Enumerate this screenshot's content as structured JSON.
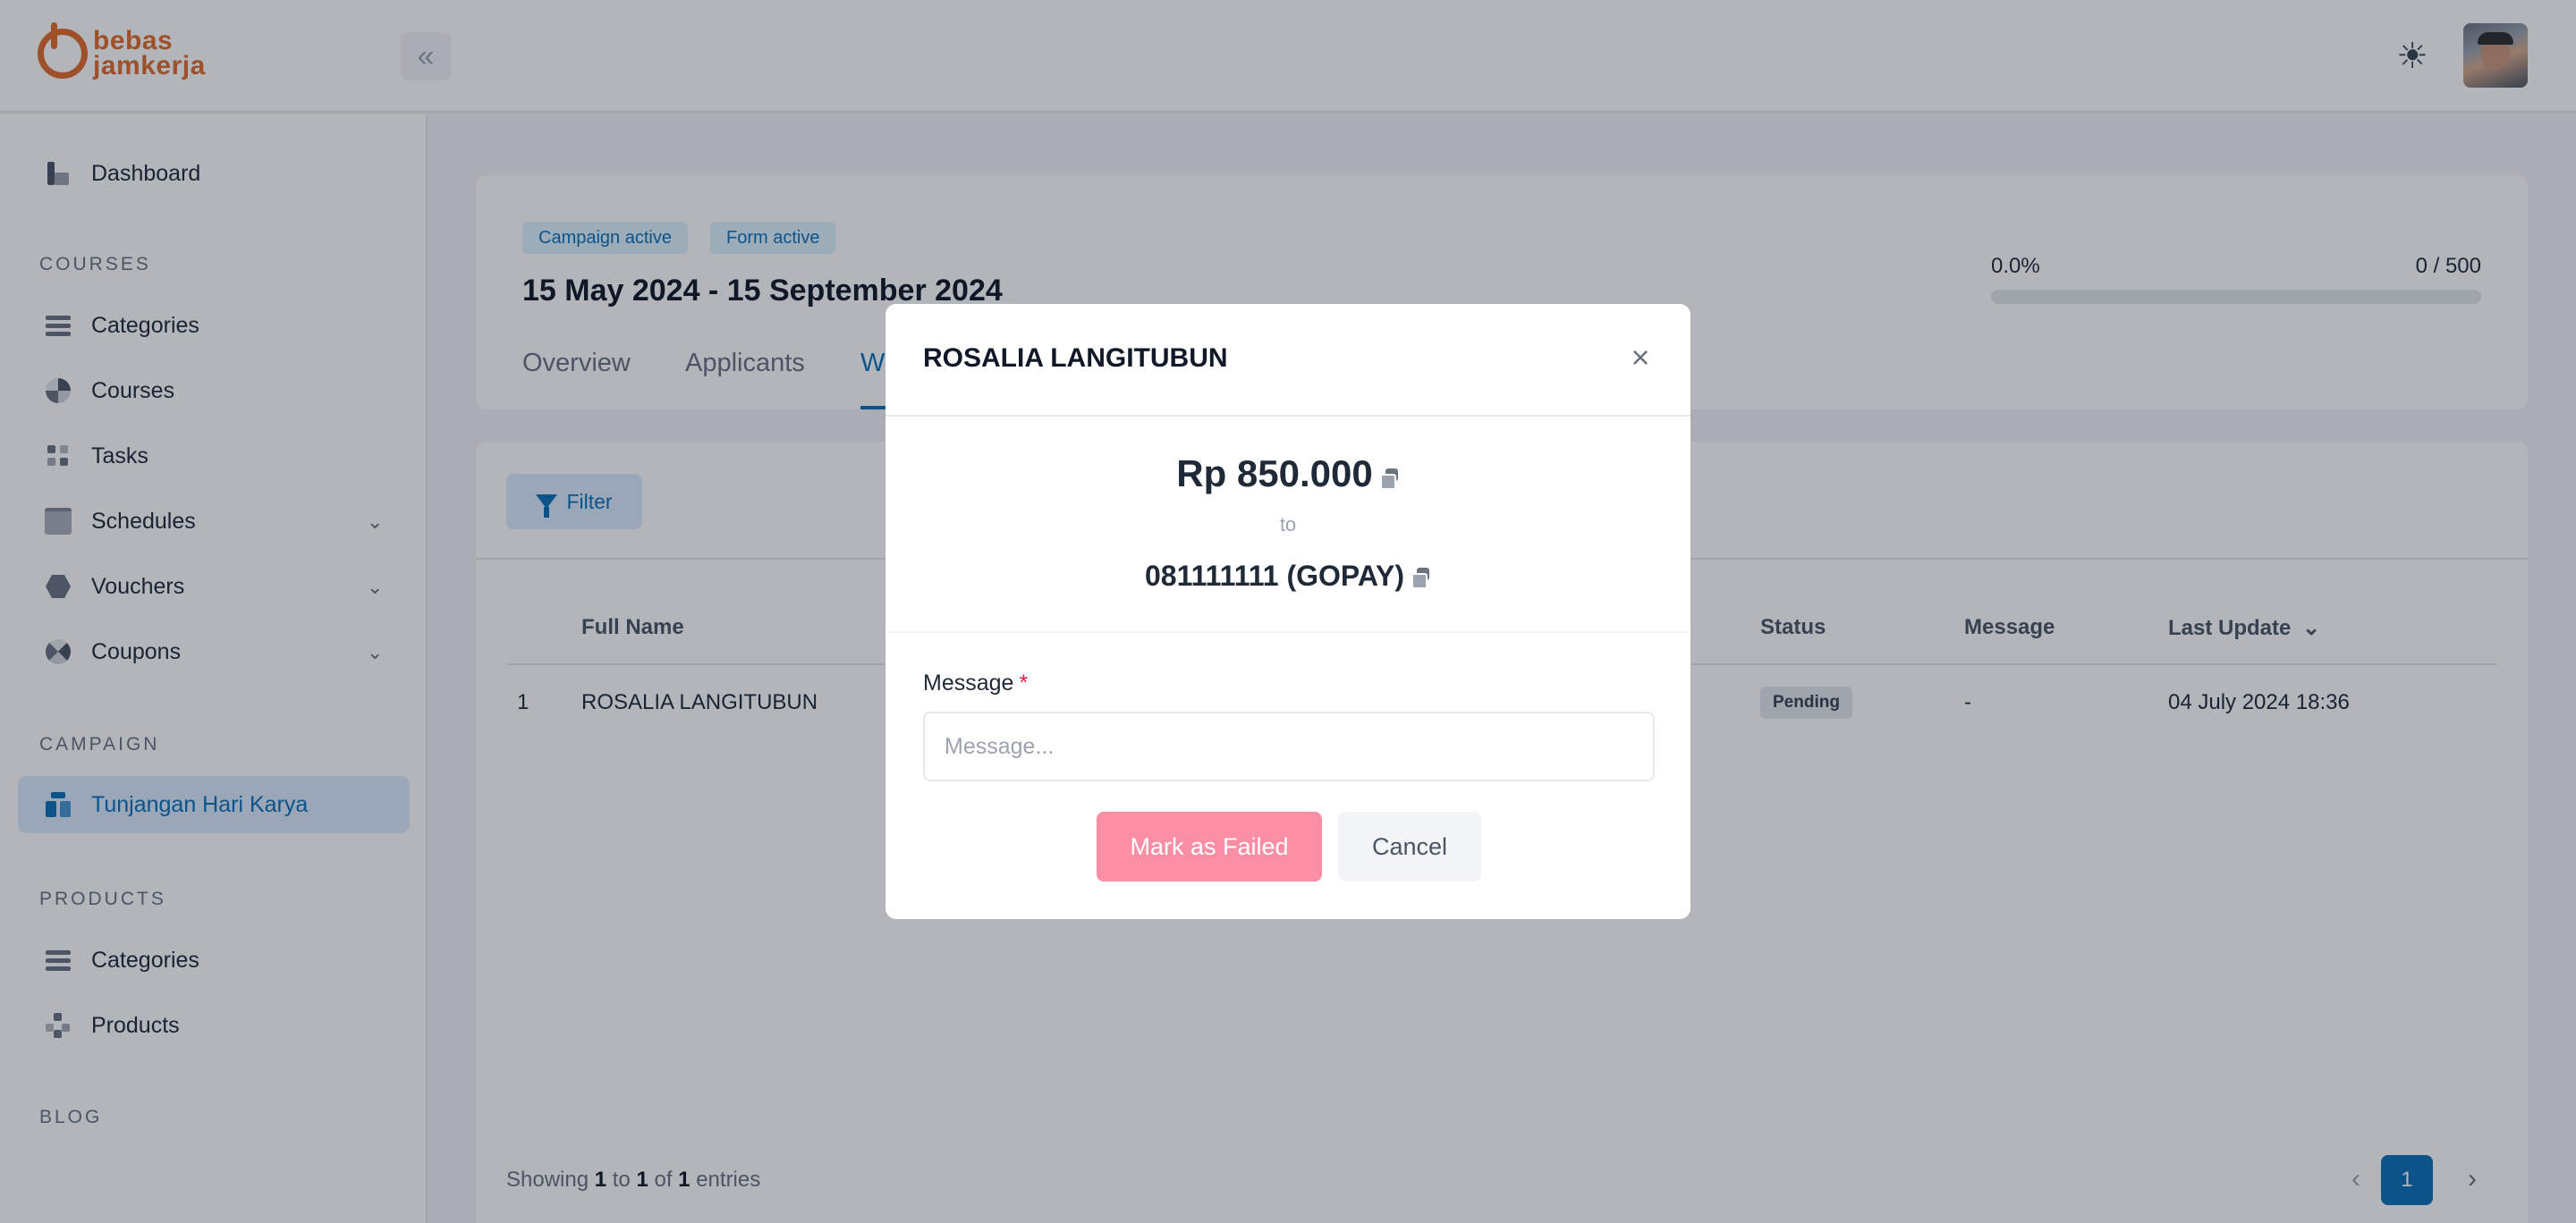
{
  "brand": {
    "line1": "bebas",
    "line2": "jamkerja",
    "color": "#e06a2c"
  },
  "topbar": {
    "collapse_icon": "chevrons-left-icon",
    "theme_icon": "sun-icon"
  },
  "sidebar": {
    "dashboard": "Dashboard",
    "sections": {
      "courses": "COURSES",
      "campaign": "CAMPAIGN",
      "products": "PRODUCTS",
      "blog": "BLOG"
    },
    "courses_items": [
      "Categories",
      "Courses",
      "Tasks",
      "Schedules",
      "Vouchers",
      "Coupons"
    ],
    "campaign_items": [
      "Tunjangan Hari Karya"
    ],
    "products_items": [
      "Categories",
      "Products"
    ]
  },
  "campaign": {
    "badges": [
      "Campaign active",
      "Form active"
    ],
    "date_range": "15 May 2024 - 15 September 2024",
    "tabs": [
      "Overview",
      "Applicants",
      "W"
    ],
    "active_tab": "W",
    "progress": {
      "percent_label": "0.0%",
      "count_label": "0 / 500",
      "fraction": 0.0
    }
  },
  "table": {
    "filter_label": "Filter",
    "headers": {
      "full_name": "Full Name",
      "status": "Status",
      "message": "Message",
      "last_update": "Last Update"
    },
    "rows": [
      {
        "no": "1",
        "full_name": "ROSALIA LANGITUBUN",
        "status": "Pending",
        "message": "-",
        "last_update": "04 July 2024 18:36"
      }
    ],
    "footer": {
      "showing": "Showing",
      "from": "1",
      "to_word": "to",
      "to": "1",
      "of_word": "of",
      "total": "1",
      "entries": "entries"
    },
    "pagination": {
      "current": "1"
    }
  },
  "modal": {
    "title": "ROSALIA LANGITUBUN",
    "amount": "Rp 850.000",
    "to_label": "to",
    "account": "081111111 (GOPAY)",
    "message_label": "Message",
    "required_mark": "*",
    "message_placeholder": "Message...",
    "message_value": "",
    "failed_button": "Mark as Failed",
    "cancel_button": "Cancel"
  },
  "colors": {
    "accent": "#0b6fb8",
    "danger_soft": "#f98ea5",
    "required": "#e11d48"
  }
}
